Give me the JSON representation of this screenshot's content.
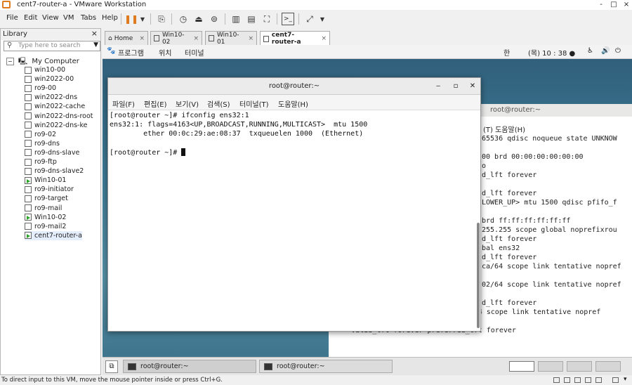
{
  "window": {
    "title": "cent7-router-a - VMware Workstation",
    "controls": [
      "-",
      "□",
      "×"
    ]
  },
  "menubar": {
    "items": [
      "File",
      "Edit",
      "View",
      "VM",
      "Tabs",
      "Help"
    ]
  },
  "library": {
    "title": "Library",
    "close": "×",
    "search_placeholder": "Type here to search",
    "root": "My Computer",
    "items": [
      {
        "label": "win10-00",
        "running": false
      },
      {
        "label": "win2022-00",
        "running": false
      },
      {
        "label": "ro9-00",
        "running": false
      },
      {
        "label": "win2022-dns",
        "running": false
      },
      {
        "label": "win2022-cache",
        "running": false
      },
      {
        "label": "win2022-dns-root",
        "running": false
      },
      {
        "label": "win2022-dns-ke",
        "running": false
      },
      {
        "label": "ro9-02",
        "running": false
      },
      {
        "label": "ro9-dns",
        "running": false
      },
      {
        "label": "ro9-dns-slave",
        "running": false
      },
      {
        "label": "ro9-ftp",
        "running": false
      },
      {
        "label": "ro9-dns-slave2",
        "running": false
      },
      {
        "label": "Win10-01",
        "running": true
      },
      {
        "label": "ro9-initiator",
        "running": false
      },
      {
        "label": "ro9-target",
        "running": false
      },
      {
        "label": "ro9-mail",
        "running": false
      },
      {
        "label": "Win10-02",
        "running": true
      },
      {
        "label": "ro9-mail2",
        "running": false
      },
      {
        "label": "cent7-router-a",
        "running": true,
        "selected": true
      }
    ]
  },
  "tabs": [
    {
      "label": "Home",
      "close": "×"
    },
    {
      "label": "Win10-02",
      "close": "×"
    },
    {
      "label": "Win10-01",
      "close": "×"
    },
    {
      "label": "cent7-router-a",
      "close": "×",
      "active": true
    }
  ],
  "gnome": {
    "apps": "프로그램",
    "places": "위치",
    "terminal": "터미널",
    "input": "한",
    "clock": "(목) 10 : 38 ●"
  },
  "bg_terminal": {
    "title": "root@router:~",
    "menu_fragment": "(T)   도움말(H)",
    "lines": [
      "65536 qdisc noqueue state UNKNOW",
      "",
      "00 brd 00:00:00:00:00:00",
      "o",
      "d_lft forever",
      "",
      "d_lft forever",
      "LOWER_UP> mtu 1500 qdisc pfifo_f",
      "",
      "brd ff:ff:ff:ff:ff:ff",
      "255.255 scope global noprefixrou",
      "d_lft forever",
      "bal ens32",
      "d_lft forever",
      "ca/64 scope link tentative nopref",
      "",
      "02/64 scope link tentative nopref",
      "",
      "d_lft forever",
      "  inet6 fe80::6d90:9e1d:2208:be45/64 scope link tentative nopref",
      "led",
      "     valid_lft forever preferred_lft forever"
    ]
  },
  "terminal": {
    "title": "root@router:~",
    "menu": [
      "파일(F)",
      "편집(E)",
      "보기(V)",
      "검색(S)",
      "터미널(T)",
      "도움말(H)"
    ],
    "lines": [
      "[root@router ~]# ifconfig ens32:1",
      "ens32:1: flags=4163<UP,BROADCAST,RUNNING,MULTICAST>  mtu 1500",
      "        ether 00:0c:29:ae:08:37  txqueuelen 1000  (Ethernet)",
      "",
      "[root@router ~]# "
    ]
  },
  "taskbar": {
    "tasks": [
      "root@router:~",
      "root@router:~"
    ]
  },
  "statusbar": {
    "text": "To direct input to this VM, move the mouse pointer inside or press Ctrl+G."
  }
}
